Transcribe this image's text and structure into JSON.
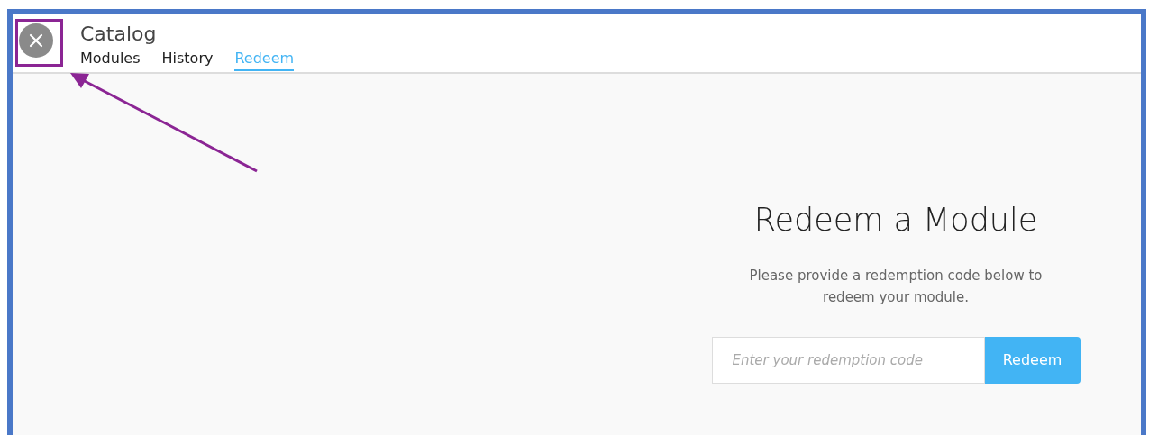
{
  "header": {
    "title": "Catalog",
    "tabs": [
      {
        "label": "Modules",
        "selected": false
      },
      {
        "label": "History",
        "selected": false
      },
      {
        "label": "Redeem",
        "selected": true
      }
    ]
  },
  "redeem": {
    "heading": "Redeem a Module",
    "description": "Please provide a redemption code below to redeem your module.",
    "code_field": {
      "placeholder": "Enter your redemption code"
    },
    "button": "Redeem"
  }
}
